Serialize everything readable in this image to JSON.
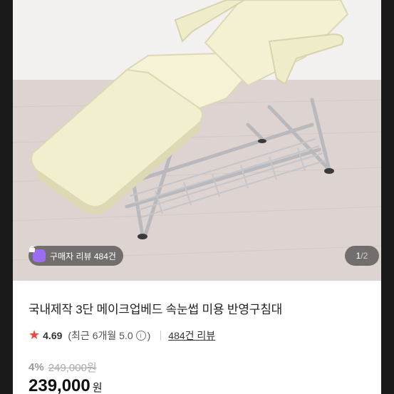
{
  "hero": {
    "review_badge": "구매자 리뷰 484건",
    "pager_current": "1",
    "pager_separator": "/",
    "pager_total": "2"
  },
  "product": {
    "title": "국내제작 3단 메이크업베드 속눈썹 미용 반영구침대",
    "rating": "4.69",
    "rating_meta": "(최근 6개월 5.0",
    "rating_meta_close": ")",
    "review_link": "484건 리뷰",
    "discount": "4%",
    "original_price": "249,000원",
    "price": "239,000",
    "currency": "원"
  },
  "colors": {
    "accent_star": "#f0463c",
    "badge_icon": "#9b6cf0"
  }
}
